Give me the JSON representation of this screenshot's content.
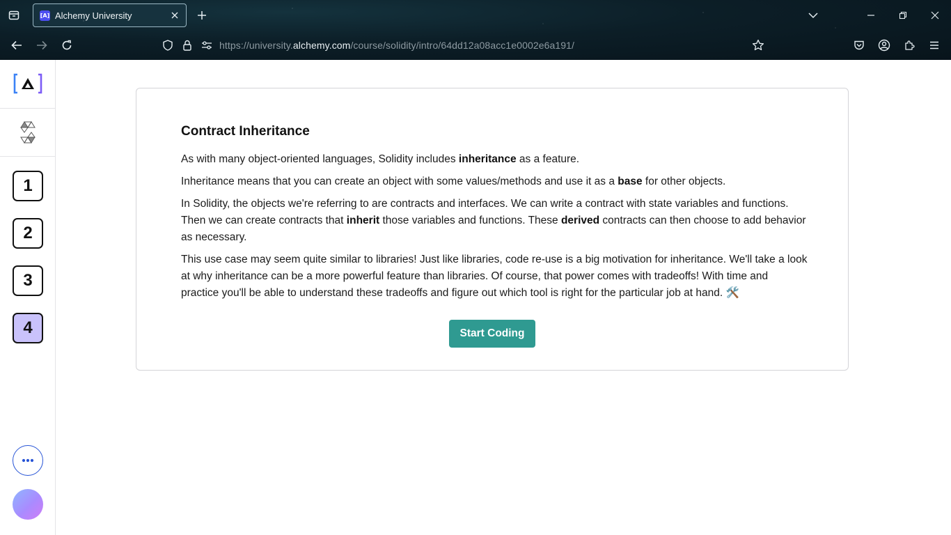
{
  "browser": {
    "tab": {
      "title": "Alchemy University",
      "favicon_text": "[A]"
    },
    "url": {
      "prefix": "https://university.",
      "domain": "alchemy.com",
      "path": "/course/solidity/intro/64dd12a08acc1e0002e6a191/"
    },
    "icons": [
      "tab-list-icon",
      "close-icon",
      "plus-icon",
      "chevron-down-icon",
      "minimize-icon",
      "restore-icon",
      "close-window-icon",
      "back-icon",
      "forward-icon",
      "reload-icon",
      "shield-icon",
      "lock-icon",
      "permissions-icon",
      "star-icon",
      "pocket-icon",
      "account-icon",
      "extensions-icon",
      "menu-icon"
    ]
  },
  "sidebar": {
    "steps": [
      {
        "label": "1",
        "active": false
      },
      {
        "label": "2",
        "active": false
      },
      {
        "label": "3",
        "active": false
      },
      {
        "label": "4",
        "active": true
      }
    ],
    "colors": {
      "active_step": "#c9c2fb",
      "more_ring": "#2754d6"
    }
  },
  "lesson": {
    "title": "Contract Inheritance",
    "p1": {
      "a": "As with many object-oriented languages, Solidity includes ",
      "b": "inheritance",
      "c": " as a feature."
    },
    "p2": {
      "a": "Inheritance means that you can create an object with some values/methods and use it as a ",
      "b": "base",
      "c": " for other objects."
    },
    "p3": {
      "a": "In Solidity, the objects we're referring to are contracts and interfaces. We can write a contract with state variables and functions. Then we can create contracts that ",
      "b": "inherit",
      "c": " those variables and functions. These ",
      "d": "derived",
      "e": " contracts can then choose to add behavior as necessary."
    },
    "p4": {
      "a": "This use case may seem quite similar to libraries! Just like libraries, code re-use is a big motivation for inheritance. We'll take a look at why inheritance can be a more powerful feature than libraries. Of course, that power comes with tradeoffs! With time and practice you'll be able to understand these tradeoffs and figure out which tool is right for the particular job at hand. ",
      "emoji": "🛠️"
    },
    "button": "Start Coding",
    "colors": {
      "button": "#2f9a91"
    }
  }
}
